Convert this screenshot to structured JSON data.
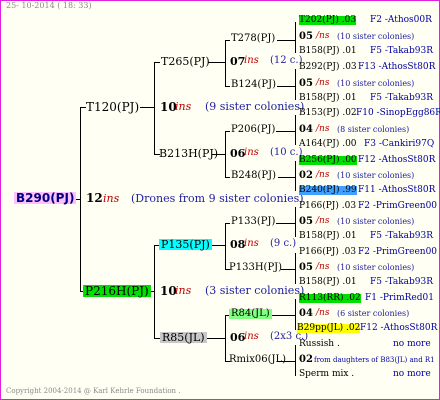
{
  "header": {
    "date": "25- 10-2014 ( 18: 33)",
    "copyright": "Copyright 2004-2014 @ Karl Kehrle Foundation ."
  },
  "colors": {
    "border": "#e020e0",
    "pink": "#ffc0ff",
    "green": "#00e000",
    "cyan": "#00ffff",
    "gray": "#c8c8c8",
    "light_green": "#80ff80",
    "blue_box": "#40a0ff",
    "yellow": "#ffff00"
  },
  "root": {
    "name": "B290(PJ)",
    "num": "12",
    "ins": "ins",
    "note": "(Drones from 9 sister colonies)"
  },
  "g1": [
    {
      "name": "T120(PJ)",
      "num": "10",
      "ins": "ins",
      "note": "(9 sister colonies)"
    },
    {
      "name": "P216H(PJ)",
      "num": "10",
      "ins": "ins",
      "note": "(3 sister colonies)"
    }
  ],
  "g2": [
    {
      "name": "T265(PJ)",
      "num": "07",
      "ins": "ins",
      "note": "(12 c.)"
    },
    {
      "name": "B213H(PJ)",
      "num": "06",
      "ins": "ins",
      "note": "(10 c.)"
    },
    {
      "name": "P135(PJ)",
      "num": "08",
      "ins": "ins",
      "note": "(9 c.)"
    },
    {
      "name": "R85(JL)",
      "num": "06",
      "ins": "ins",
      "note": "(2x3 c.)"
    }
  ],
  "g3": [
    "T278(PJ)",
    "B124(PJ)",
    "P206(PJ)",
    "B248(PJ)",
    "P133(PJ)",
    "P133H(PJ)",
    "R84(JL)",
    "Rmix06(JL)"
  ],
  "g4": [
    {
      "top": "T202(PJ) .03",
      "top_src": "F2 -Athos00R",
      "num": "05",
      "ins": "/ns",
      "note": "(10 sister colonies)",
      "bot": "B158(PJ) .01",
      "bot_src": "F5 -Takab93R"
    },
    {
      "top": "B292(PJ) .03",
      "top_src": "F13 -AthosSt80R",
      "num": "05",
      "ins": "/ns",
      "note": "(10 sister colonies)",
      "bot": "B158(PJ) .01",
      "bot_src": "F5 -Takab93R"
    },
    {
      "top": "B153(PJ) .02",
      "top_src": "F10 -SinopEgg86R",
      "num": "04",
      "ins": "/ns",
      "note": "(8 sister colonies)",
      "bot": "A164(PJ) .00",
      "bot_src": "F3 -Cankiri97Q"
    },
    {
      "top": "B256(PJ) .00",
      "top_src": "F12 -AthosSt80R",
      "num": "02",
      "ins": "/ns",
      "note": "(10 sister colonies)",
      "bot": "B240(PJ) .99",
      "bot_src": "F11 -AthosSt80R"
    },
    {
      "top": "P166(PJ) .03",
      "top_src": "F2 -PrimGreen00",
      "num": "05",
      "ins": "/ns",
      "note": "(10 sister colonies)",
      "bot": "B158(PJ) .01",
      "bot_src": "F5 -Takab93R"
    },
    {
      "top": "P166(PJ) .03",
      "top_src": "F2 -PrimGreen00",
      "num": "05",
      "ins": "/ns",
      "note": "(10 sister colonies)",
      "bot": "B158(PJ) .01",
      "bot_src": "F5 -Takab93R"
    },
    {
      "top": "R113(RR) .02",
      "top_src": "F1 -PrimRed01",
      "num": "04",
      "ins": "/ns",
      "note": "(6 sister colonies)",
      "bot": "B29pp(JL) .02",
      "bot_src": "F12 -AthosSt80R"
    },
    {
      "top": "Russish .",
      "top_src": "no more",
      "num": "02",
      "ins": "",
      "note": "from daughters of B83(JL) and R1",
      "bot": "Sperm mix .",
      "bot_src": "no more"
    }
  ]
}
